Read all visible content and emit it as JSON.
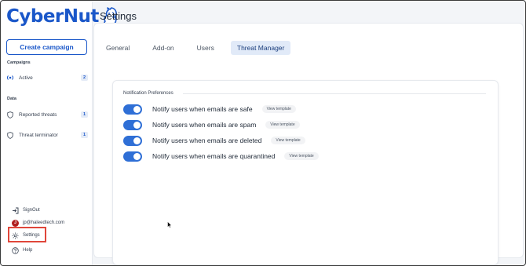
{
  "brand": {
    "name": "CyberNut",
    "accent": "#1a57c9",
    "logo_icon": "squirrel-icon"
  },
  "sidebar": {
    "create_button": "Create campaign",
    "sections": [
      {
        "label": "Campaigns",
        "items": [
          {
            "label": "Active",
            "count": "2",
            "icon": "broadcast-icon"
          }
        ]
      },
      {
        "label": "Data",
        "items": [
          {
            "label": "Reported threats",
            "count": "1",
            "icon": "shield-icon"
          },
          {
            "label": "Threat terminator",
            "count": "1",
            "icon": "shield-icon"
          }
        ]
      }
    ],
    "bottom": {
      "signout": "SignOut",
      "email": "jp@haleedtech.com",
      "avatar_initial": "J",
      "settings": "Settings",
      "help": "Help"
    }
  },
  "page": {
    "title": "Settings"
  },
  "tabs": [
    {
      "label": "General",
      "active": false
    },
    {
      "label": "Add-on",
      "active": false
    },
    {
      "label": "Users",
      "active": false
    },
    {
      "label": "Threat Manager",
      "active": true
    }
  ],
  "preferences": {
    "title": "Notification Preferences",
    "items": [
      {
        "label": "Notify users when emails are safe",
        "enabled": true,
        "button": "View template"
      },
      {
        "label": "Notify users when emails are spam",
        "enabled": true,
        "button": "View template"
      },
      {
        "label": "Notify users when emails are deleted",
        "enabled": true,
        "button": "View template"
      },
      {
        "label": "Notify users when emails are quarantined",
        "enabled": true,
        "button": "View template"
      }
    ]
  },
  "colors": {
    "toggle_on": "#2f6fd6",
    "highlight": "#e0463a"
  }
}
